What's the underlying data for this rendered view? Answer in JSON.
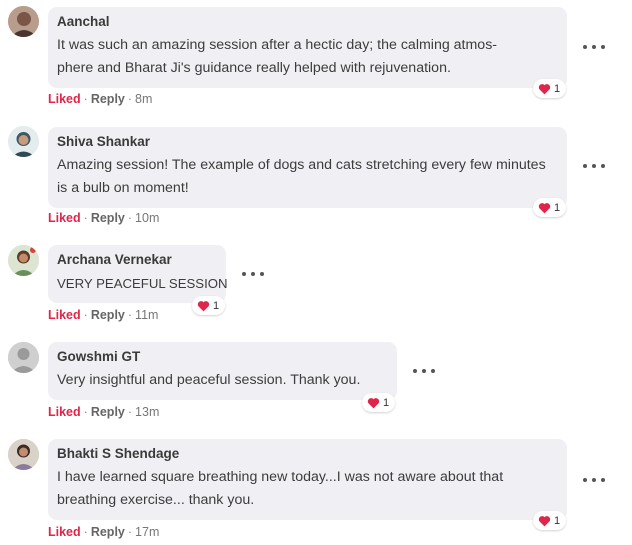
{
  "comments": [
    {
      "author": "Aanchal",
      "text": "It was such an amazing session after a hectic day; the calming atmos-phere and Bharat Ji's guidance really helped with rejuvenation.",
      "reaction_count": "1",
      "liked_label": "Liked",
      "reply_label": "Reply",
      "time": "8m"
    },
    {
      "author": "Shiva Shankar",
      "text": "Amazing session! The example of dogs and cats stretching every few minutes is a bulb on moment!",
      "reaction_count": "1",
      "liked_label": "Liked",
      "reply_label": "Reply",
      "time": "10m"
    },
    {
      "author": "Archana Vernekar",
      "text": "VERY PEACEFUL SESSION",
      "reaction_count": "1",
      "liked_label": "Liked",
      "reply_label": "Reply",
      "time": "11m"
    },
    {
      "author": "Gowshmi GT",
      "text": "Very insightful and peaceful session. Thank you.",
      "reaction_count": "1",
      "liked_label": "Liked",
      "reply_label": "Reply",
      "time": "13m"
    },
    {
      "author": "Bhakti S Shendage",
      "text": "I have learned square breathing new today...I was not aware about that breathing exercise... thank you.",
      "reaction_count": "1",
      "liked_label": "Liked",
      "reply_label": "Reply",
      "time": "17m"
    }
  ],
  "meta_separator": "·",
  "colors": {
    "liked": "#e0254a",
    "bubble": "#f0f0f4",
    "heart": "#e0254a"
  },
  "icons": {
    "more": "more-options-icon",
    "reaction": "heart-icon",
    "avatar_default": "default-user-icon"
  }
}
